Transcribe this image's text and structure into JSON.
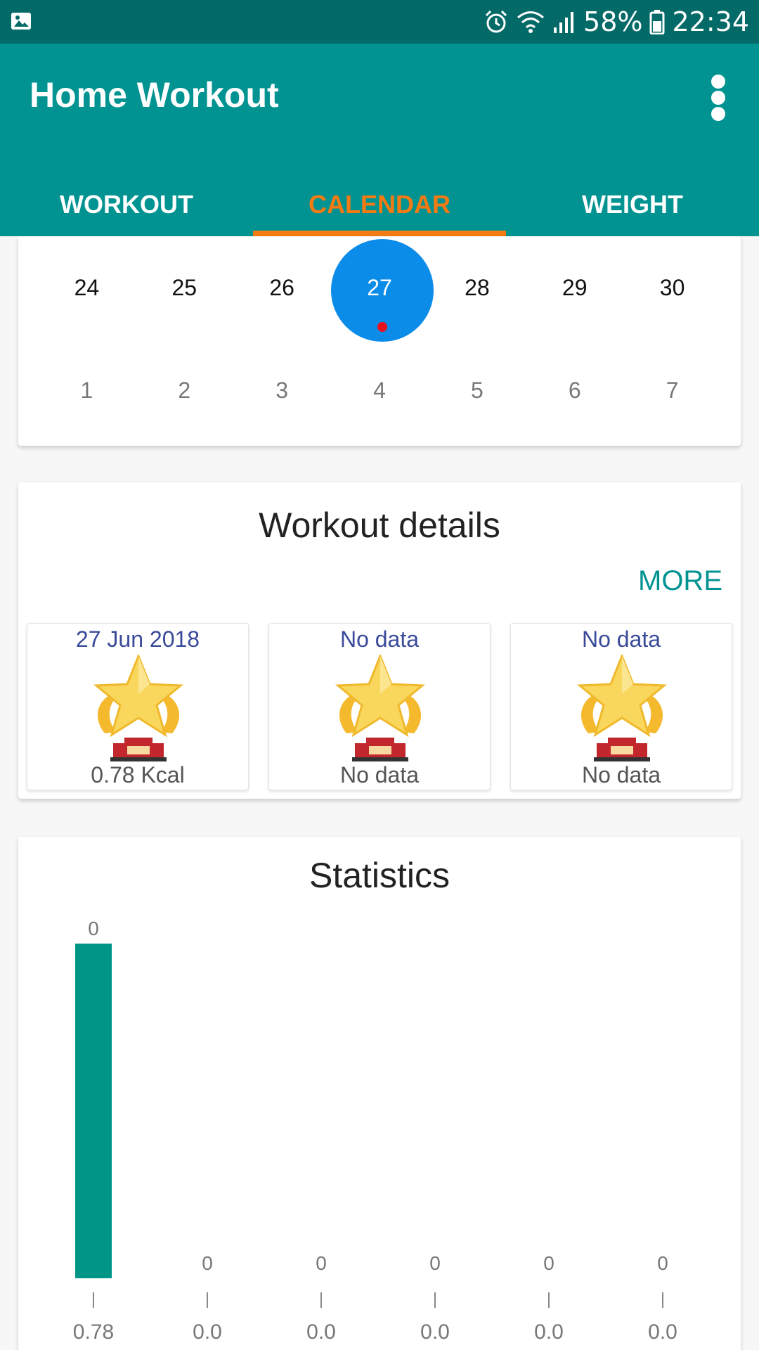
{
  "status_bar": {
    "battery": "58%",
    "time": "22:34",
    "icons": [
      "gallery-icon",
      "alarm-icon",
      "wifi-icon",
      "signal-icon",
      "battery-icon"
    ]
  },
  "app_bar": {
    "title": "Home Workout",
    "menu_icon": "more-vert-icon",
    "background": "#019391"
  },
  "tabs": [
    {
      "label": "WORKOUT",
      "active": false
    },
    {
      "label": "CALENDAR",
      "active": true
    },
    {
      "label": "WEIGHT",
      "active": false
    }
  ],
  "accent_color": "#f47b13",
  "calendar": {
    "row1": [
      "24",
      "25",
      "26",
      "27",
      "28",
      "29",
      "30"
    ],
    "row2": [
      "1",
      "2",
      "3",
      "4",
      "5",
      "6",
      "7"
    ],
    "selected": "27",
    "selected_color": "#0c8ce9"
  },
  "workout_details": {
    "title": "Workout details",
    "more_label": "MORE",
    "tiles": [
      {
        "date": "27 Jun 2018",
        "value": "0.78 Kcal",
        "icon": "trophy-icon"
      },
      {
        "date": "No data",
        "value": "No data",
        "icon": "trophy-icon"
      },
      {
        "date": "No data",
        "value": "No data",
        "icon": "trophy-icon"
      }
    ]
  },
  "statistics": {
    "title": "Statistics"
  },
  "chart_data": {
    "type": "bar",
    "categories": [
      "0.78",
      "0.0",
      "0.0",
      "0.0",
      "0.0",
      "0.0"
    ],
    "values": [
      0.78,
      0,
      0,
      0,
      0,
      0
    ],
    "data_labels": [
      "0",
      "0",
      "0",
      "0",
      "0",
      "0"
    ],
    "bar_color": "#009687",
    "grid": false,
    "legend": "none"
  }
}
